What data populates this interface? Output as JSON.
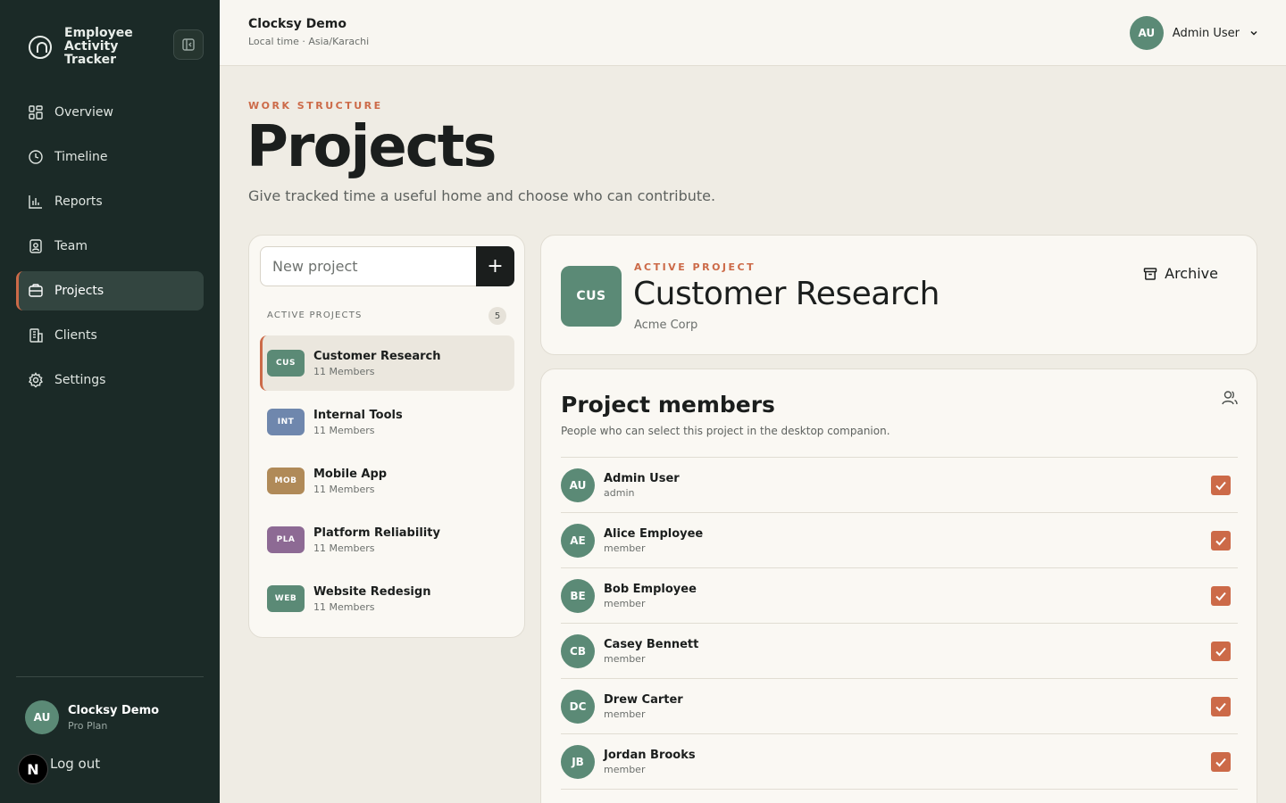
{
  "app": {
    "title": "Employee Activity Tracker"
  },
  "sidebar": {
    "items": [
      {
        "label": "Overview",
        "icon": "grid-icon"
      },
      {
        "label": "Timeline",
        "icon": "clock-icon"
      },
      {
        "label": "Reports",
        "icon": "bar-chart-icon"
      },
      {
        "label": "Team",
        "icon": "team-icon"
      },
      {
        "label": "Projects",
        "icon": "projects-icon",
        "active": true
      },
      {
        "label": "Clients",
        "icon": "building-icon"
      },
      {
        "label": "Settings",
        "icon": "gear-icon"
      }
    ],
    "user": {
      "initials": "AU",
      "name": "Clocksy Demo",
      "plan": "Pro Plan"
    },
    "logout_label": "Log out",
    "badge": "N"
  },
  "header": {
    "org_name": "Clocksy Demo",
    "local_time": "Local time · Asia/Karachi",
    "user": {
      "initials": "AU",
      "name": "Admin User"
    }
  },
  "page": {
    "eyebrow": "WORK STRUCTURE",
    "title": "Projects",
    "subtitle": "Give tracked time a useful home and choose who can contribute."
  },
  "project_list": {
    "new_placeholder": "New project",
    "add_label": "+",
    "section_label": "ACTIVE PROJECTS",
    "count": "5",
    "projects": [
      {
        "code": "CUS",
        "name": "Customer Research",
        "members": "11 Members",
        "color": "#5b8a76",
        "active": true
      },
      {
        "code": "INT",
        "name": "Internal Tools",
        "members": "11 Members",
        "color": "#6f87ad"
      },
      {
        "code": "MOB",
        "name": "Mobile App",
        "members": "11 Members",
        "color": "#b08a58"
      },
      {
        "code": "PLA",
        "name": "Platform Reliability",
        "members": "11 Members",
        "color": "#8d6a94"
      },
      {
        "code": "WEB",
        "name": "Website Redesign",
        "members": "11 Members",
        "color": "#5b8a76"
      }
    ]
  },
  "active_project": {
    "code": "CUS",
    "eyebrow": "ACTIVE PROJECT",
    "name": "Customer Research",
    "client": "Acme Corp",
    "archive_label": "Archive"
  },
  "members": {
    "title": "Project members",
    "subtitle": "People who can select this project in the desktop companion.",
    "list": [
      {
        "initials": "AU",
        "name": "Admin User",
        "role": "admin",
        "checked": true
      },
      {
        "initials": "AE",
        "name": "Alice Employee",
        "role": "member",
        "checked": true
      },
      {
        "initials": "BE",
        "name": "Bob Employee",
        "role": "member",
        "checked": true
      },
      {
        "initials": "CB",
        "name": "Casey Bennett",
        "role": "member",
        "checked": true
      },
      {
        "initials": "DC",
        "name": "Drew Carter",
        "role": "member",
        "checked": true
      },
      {
        "initials": "JB",
        "name": "Jordan Brooks",
        "role": "member",
        "checked": true
      }
    ]
  },
  "colors": {
    "accent": "#cc6a48",
    "sidebar_bg": "#1b2a27",
    "avatar": "#5b8a76"
  }
}
